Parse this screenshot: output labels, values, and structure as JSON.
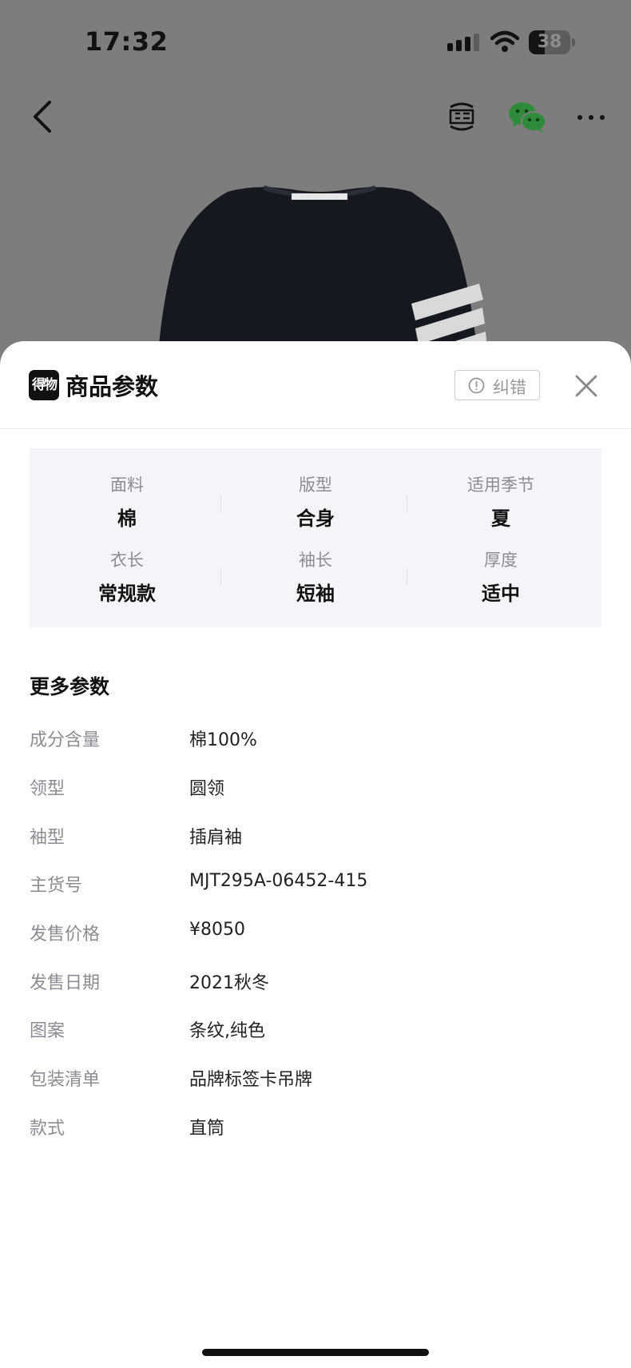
{
  "status_bar": {
    "time": "17:32",
    "battery": "38",
    "battery_level": 0.38
  },
  "nav": {
    "back_icon": "chevron-left-icon",
    "resell_icon": "resell-icon",
    "share_icon": "wechat-icon",
    "more_icon": "ellipsis-icon"
  },
  "sheet": {
    "logo_text": "得物",
    "title": "商品参数",
    "report_label": "纠错",
    "close_icon": "close-icon"
  },
  "params": [
    {
      "label": "面料",
      "value": "棉"
    },
    {
      "label": "版型",
      "value": "合身"
    },
    {
      "label": "适用季节",
      "value": "夏"
    },
    {
      "label": "衣长",
      "value": "常规款"
    },
    {
      "label": "袖长",
      "value": "短袖"
    },
    {
      "label": "厚度",
      "value": "适中"
    }
  ],
  "more_params": {
    "title": "更多参数",
    "rows": [
      {
        "key": "成分含量",
        "value": "棉100%"
      },
      {
        "key": "领型",
        "value": "圆领"
      },
      {
        "key": "袖型",
        "value": "插肩袖"
      },
      {
        "key": "主货号",
        "value": "MJT295A-06452-415"
      },
      {
        "key": "发售价格",
        "value": "¥8050"
      },
      {
        "key": "发售日期",
        "value": "2021秋冬"
      },
      {
        "key": "图案",
        "value": "条纹,纯色"
      },
      {
        "key": "包装清单",
        "value": "品牌标签卡吊牌"
      },
      {
        "key": "款式",
        "value": "直筒"
      }
    ]
  },
  "colors": {
    "overlay": "#7d7d7d",
    "card_bg": "#f5f5f9",
    "label_gray": "#8c8c94",
    "wechat_green": "#2e8b3a"
  }
}
